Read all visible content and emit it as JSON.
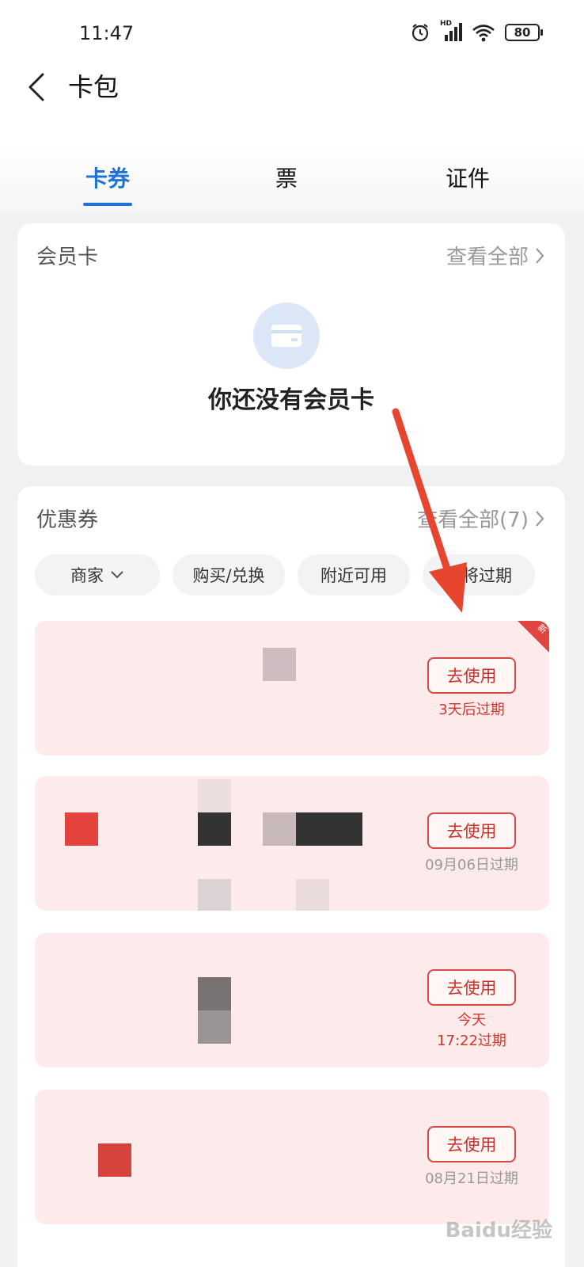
{
  "status_bar": {
    "time": "11:47",
    "network": "HD",
    "battery": "80"
  },
  "header": {
    "title": "卡包"
  },
  "tabs": [
    {
      "label": "卡券",
      "active": true
    },
    {
      "label": "票",
      "active": false
    },
    {
      "label": "证件",
      "active": false
    }
  ],
  "member_card": {
    "title": "会员卡",
    "view_all": "查看全部",
    "empty_text": "你还没有会员卡"
  },
  "coupons": {
    "title": "优惠券",
    "view_all": "查看全部(7)",
    "filters": [
      "商家",
      "购买/兑换",
      "附近可用",
      "即将过期"
    ],
    "items": [
      {
        "use_label": "去使用",
        "expire_line1": "3天后过期",
        "expire_line2": "",
        "expire_color": "red",
        "is_new": true,
        "new_label": "新"
      },
      {
        "use_label": "去使用",
        "expire_line1": "09月06日过期",
        "expire_line2": "",
        "expire_color": "gray",
        "is_new": false
      },
      {
        "use_label": "去使用",
        "expire_line1": "今天",
        "expire_line2": "17:22过期",
        "expire_color": "red",
        "is_new": false
      },
      {
        "use_label": "去使用",
        "expire_line1": "08月21日过期",
        "expire_line2": "",
        "expire_color": "gray",
        "is_new": false
      }
    ]
  },
  "watermark": "Baidu经验",
  "colors": {
    "accent": "#1f73d6",
    "coupon_red": "#d4352d",
    "coupon_bg": "#fdebeb"
  }
}
